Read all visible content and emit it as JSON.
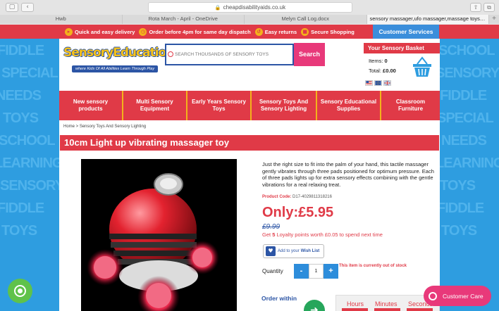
{
  "browser": {
    "url": "cheapdisabilityaids.co.uk",
    "tabs": [
      {
        "label": "Hwb",
        "active": false
      },
      {
        "label": "Rota March - April - OneDrive",
        "active": false
      },
      {
        "label": "Melyn Call Log.docx",
        "active": false
      },
      {
        "label": "sensory massager,ufo massager,massage toys disab...",
        "active": true
      }
    ]
  },
  "promo": {
    "items": [
      {
        "label": "Quick and easy delivery",
        "icon": "truck-icon"
      },
      {
        "label": "Order before 4pm for same day dispatch",
        "icon": "clock-icon"
      },
      {
        "label": "Easy returns",
        "icon": "return-icon"
      },
      {
        "label": "Secure Shopping",
        "icon": "lock-icon"
      }
    ],
    "customer_services": "Customer Services"
  },
  "logo": {
    "text": "SensoryEducation",
    "tagline": "where Kids Of All Abilities Learn Through Play"
  },
  "search": {
    "placeholder": "SEARCH THOUSANDS OF SENSORY TOYS",
    "button": "Search"
  },
  "basket": {
    "title": "Your Sensory Basket",
    "items_label": "Items:",
    "items_value": "0",
    "total_label": "Total:",
    "total_value": "£0.00"
  },
  "categories": [
    {
      "label": "New sensory products"
    },
    {
      "label": "Multi Sensory Equipment"
    },
    {
      "label": "Early Years Sensory Toys"
    },
    {
      "label": "Sensory Toys And Sensory Lighting"
    },
    {
      "label": "Sensory Educational Supplies"
    },
    {
      "label": "Classroom Furniture"
    }
  ],
  "breadcrumb": "Home > Sensory Toys And Sensory Lighting",
  "product": {
    "title": "10cm Light up vibrating massager toy",
    "description": "Just the right size to fit into the palm of your hand, this tactile massager gently vibrates through three pads positioned for optimum pressure. Each of three pads lights up for extra sensory effects combining with the gentle vibrations for a real relaxing treat.",
    "code_label": "Product Code:",
    "code_value": "D17-4029811318216",
    "price": "Only:£5.95",
    "old_price": "£9.99",
    "loyalty_prefix": "Get",
    "loyalty_points": "5",
    "loyalty_suffix": "Loyalty points worth £0.05 to spend next time",
    "wishlist_prefix": "Add to your",
    "wishlist_bold": "Wish List",
    "quantity_label": "Quantity",
    "quantity_value": "1",
    "minus": "-",
    "plus": "+",
    "stock_status": "This item is currently out of stock",
    "order_within": "Order within",
    "timer": {
      "hours": "Hours",
      "minutes": "Minutes",
      "seconds": "Seconds"
    }
  },
  "background_words": [
    "FIDDLE",
    "SPECIAL",
    "NEEDS",
    "TOYS",
    "SCHOOL",
    "LEARNING",
    "SENSORY",
    "FIDDLE",
    "TOYS"
  ],
  "widgets": {
    "customer_care": "Customer Care"
  },
  "colors": {
    "brand_red": "#e03a47",
    "brand_blue": "#2c55a5",
    "accent_pink": "#e8397a",
    "accent_yellow": "#f3b21b",
    "sky_blue": "#2e9de0"
  }
}
